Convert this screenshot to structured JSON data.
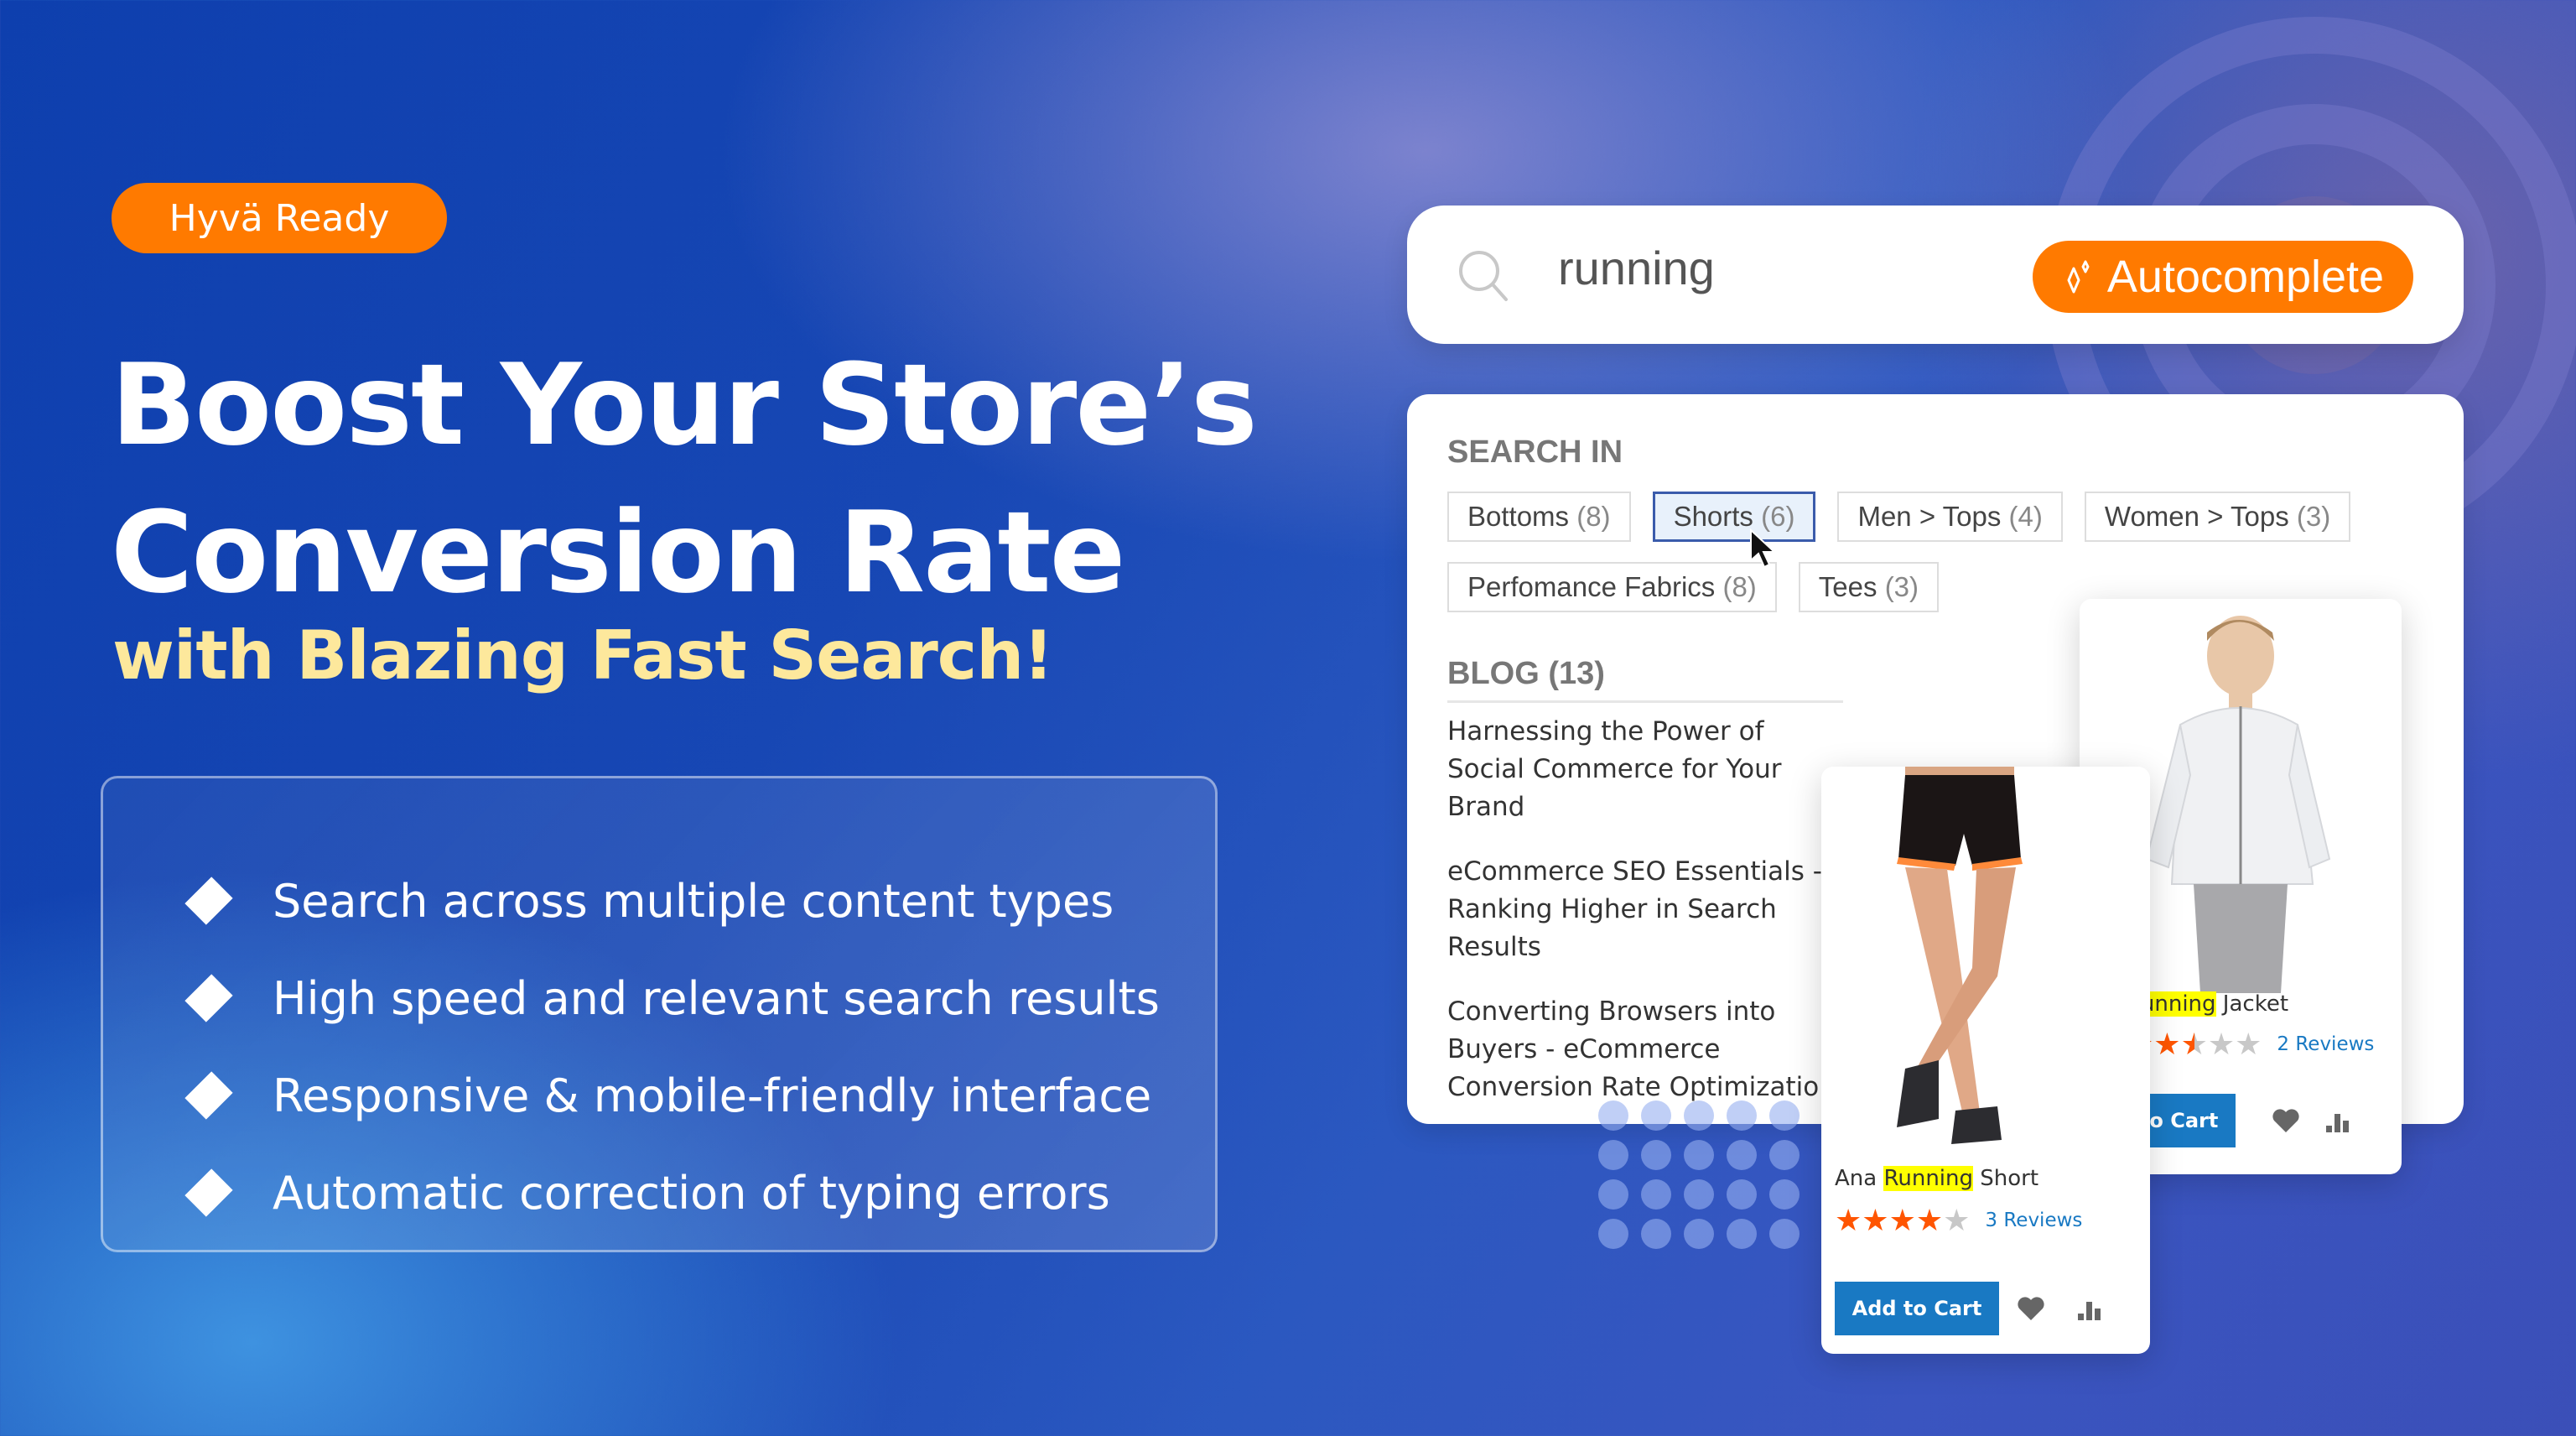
{
  "badge": "Hyvä Ready",
  "headline": {
    "line1": "Boost Your Store’s",
    "line2": "Conversion Rate",
    "subline": "with Blazing Fast Search!"
  },
  "features": [
    "Search across multiple content types",
    "High speed and relevant search results",
    "Responsive & mobile-friendly interface",
    "Automatic correction of typing errors"
  ],
  "search": {
    "query": "running",
    "button_label": "Autocomplete",
    "button_icon": "sparkle-icon",
    "search_icon": "search-icon"
  },
  "dropdown": {
    "search_in_title": "SEARCH IN",
    "categories": [
      {
        "name": "Bottoms",
        "count": "(8)",
        "active": false
      },
      {
        "name": "Shorts",
        "count": "(6)",
        "active": true
      },
      {
        "name": "Men > Tops",
        "count": "(4)",
        "active": false
      },
      {
        "name": "Women > Tops",
        "count": "(3)",
        "active": false
      },
      {
        "name": "Perfomance Fabrics",
        "count": "(8)",
        "active": false
      },
      {
        "name": "Tees",
        "count": "(3)",
        "active": false
      }
    ],
    "blog_title": "BLOG (13)",
    "blog_posts": [
      "Harnessing the Power of Social Commerce for Your Brand",
      "eCommerce SEO Essentials - Ranking Higher in Search Results",
      "Converting Browsers into Buyers - eCommerce Conversion Rate Optimization"
    ]
  },
  "products": [
    {
      "name_pre": "",
      "name_highlight": "Running",
      "name_post": " Jacket",
      "rating": 2.5,
      "rating_max": 5,
      "reviews": "2  Reviews",
      "cart_label": "Add to Cart"
    },
    {
      "name_pre": "Ana ",
      "name_highlight": "Running",
      "name_post": " Short",
      "rating": 4,
      "rating_max": 5,
      "reviews": "3  Reviews",
      "cart_label": "Add to Cart"
    }
  ],
  "colors": {
    "accent_orange": "#ff7a00",
    "headline_yellow": "#fde89c",
    "cart_blue": "#1979c3",
    "star_orange": "#ff5501",
    "highlight_yellow": "#ffff00"
  }
}
